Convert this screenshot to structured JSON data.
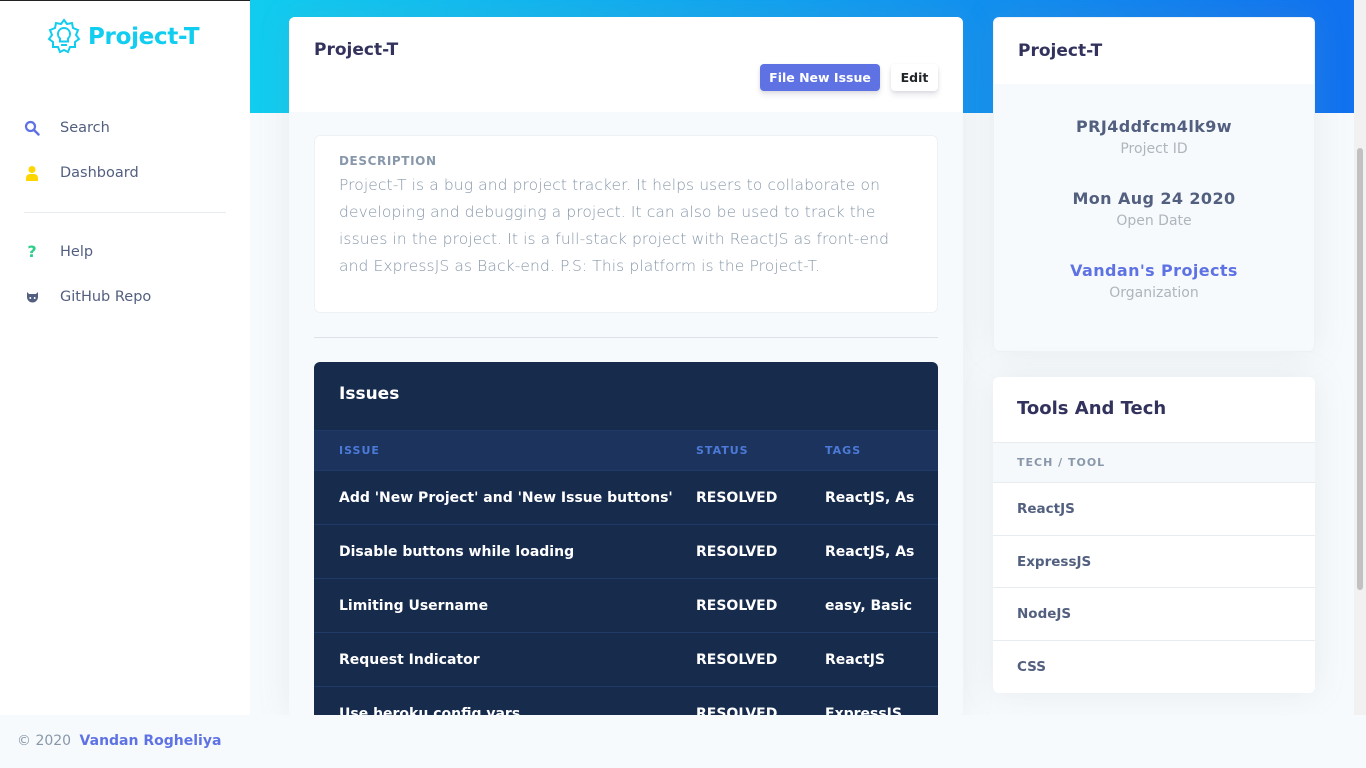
{
  "brand": {
    "name": "Project-T"
  },
  "sidebar": {
    "items": [
      {
        "label": "Search",
        "icon": "search-icon",
        "color": "#5e72e4"
      },
      {
        "label": "Dashboard",
        "icon": "user-icon",
        "color": "#ffd600"
      },
      {
        "label": "Help",
        "icon": "question-icon",
        "color": "#2dce89"
      },
      {
        "label": "GitHub Repo",
        "icon": "github-icon",
        "color": "#525f7f"
      }
    ]
  },
  "main": {
    "title": "Project-T",
    "file_issue_label": "File New Issue",
    "edit_label": "Edit",
    "description_label": "DESCRIPTION",
    "description": "Project-T is a bug and project tracker. It helps users to collaborate on developing and debugging a project. It can also be used to track the issues in the project. It is a full-stack project with ReactJS as front-end and ExpressJS as Back-end. P.S: This platform is the Project-T."
  },
  "issues": {
    "title": "Issues",
    "columns": [
      "ISSUE",
      "STATUS",
      "TAGS"
    ],
    "rows": [
      {
        "issue": "Add 'New Project' and 'New Issue buttons'",
        "status": "RESOLVED",
        "tags": "ReactJS, As"
      },
      {
        "issue": "Disable buttons while loading",
        "status": "RESOLVED",
        "tags": "ReactJS, As"
      },
      {
        "issue": "Limiting Username",
        "status": "RESOLVED",
        "tags": "easy, Basic"
      },
      {
        "issue": "Request Indicator",
        "status": "RESOLVED",
        "tags": "ReactJS"
      },
      {
        "issue": "Use heroku config vars",
        "status": "RESOLVED",
        "tags": "ExpressJS,"
      }
    ]
  },
  "info": {
    "title": "Project-T",
    "project_id": "PRJ4ddfcm4lk9w",
    "project_id_label": "Project ID",
    "open_date": "Mon Aug 24 2020",
    "open_date_label": "Open Date",
    "organization": "Vandan's Projects",
    "organization_label": "Organization"
  },
  "tools": {
    "title": "Tools And Tech",
    "column": "TECH / TOOL",
    "items": [
      "ReactJS",
      "ExpressJS",
      "NodeJS",
      "CSS"
    ]
  },
  "footer": {
    "copyright": "© 2020",
    "author": "Vandan Rogheliya"
  },
  "colors": {
    "primary": "#5e72e4",
    "brand": "#11cdef",
    "issues_bg": "#172b4d",
    "header_gradient_start": "#11cdef",
    "header_gradient_end": "#1171ef"
  }
}
